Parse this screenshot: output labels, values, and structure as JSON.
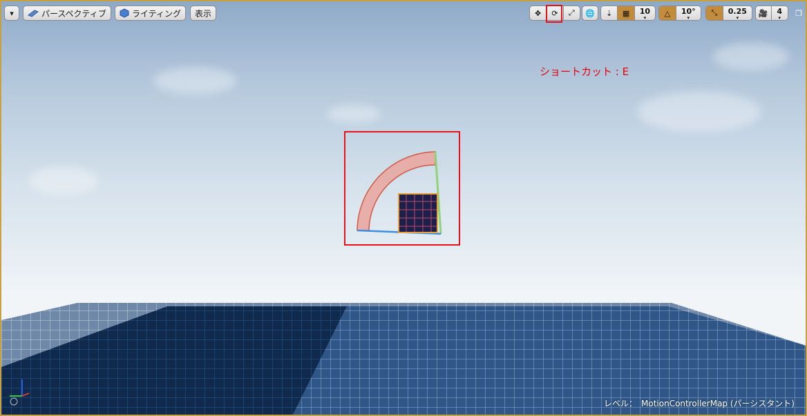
{
  "toolbar": {
    "menu_label": "▾",
    "perspective_label": "パースペクティブ",
    "lighting_label": "ライティング",
    "show_label": "表示",
    "grid_snap_value": "10",
    "rotation_snap_value": "10°",
    "scale_snap_value": "0.25",
    "camera_speed_value": "4"
  },
  "annotation": {
    "shortcut_text": "ショートカット : E"
  },
  "status": {
    "level_prefix": "レベル：",
    "level_name": "MotionControllerMap (パーシスタント)"
  },
  "colors": {
    "highlight": "#e8101a",
    "toolbar_active": "#c38c3c",
    "viewport_border": "#c8a040"
  }
}
